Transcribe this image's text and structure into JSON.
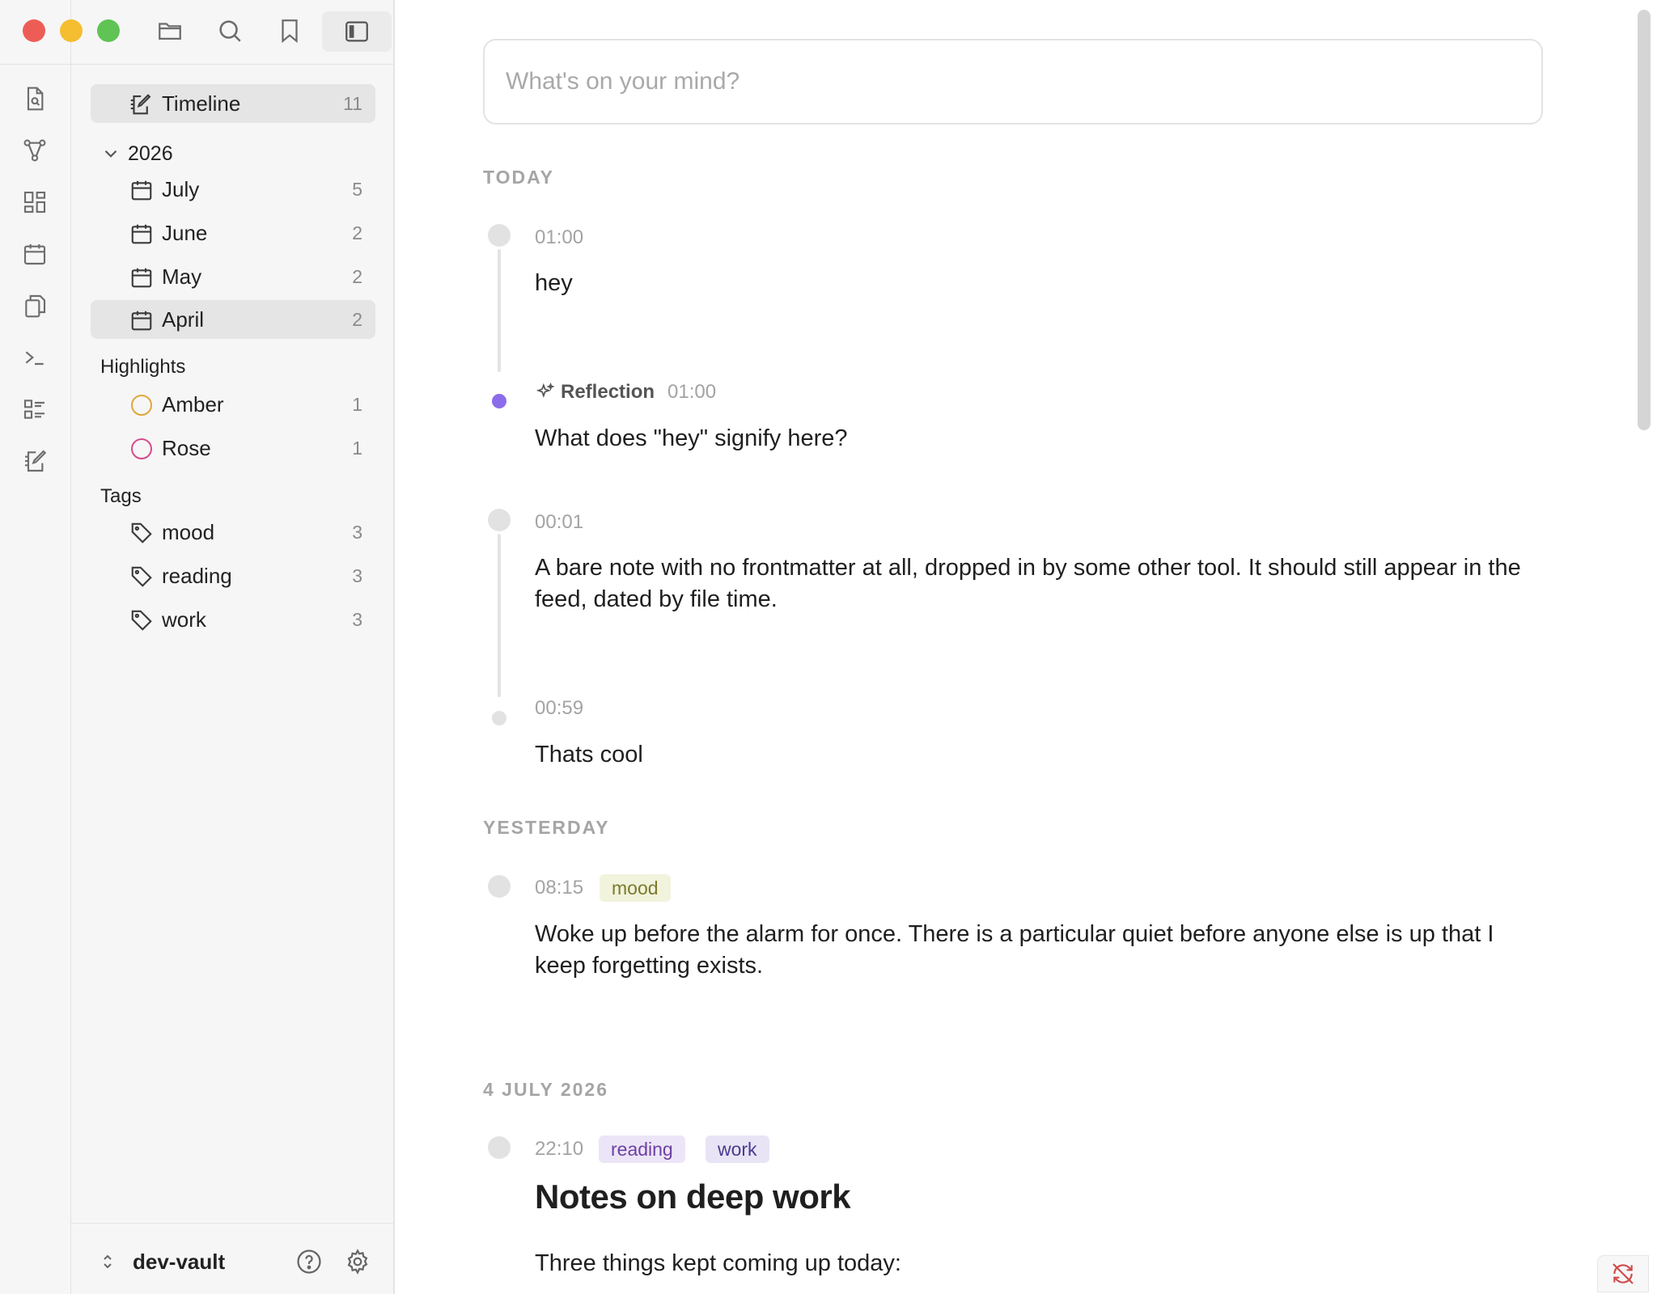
{
  "window": {
    "traffic_colors": [
      "#ee5d55",
      "#f5be30",
      "#5fc454"
    ]
  },
  "sidebar": {
    "timeline": {
      "label": "Timeline",
      "count": "11"
    },
    "year": {
      "label": "2026"
    },
    "months": [
      {
        "label": "July",
        "count": "5"
      },
      {
        "label": "June",
        "count": "2"
      },
      {
        "label": "May",
        "count": "2"
      },
      {
        "label": "April",
        "count": "2"
      }
    ],
    "highlights": {
      "heading": "Highlights",
      "items": [
        {
          "label": "Amber",
          "count": "1",
          "color": "#e0a63a"
        },
        {
          "label": "Rose",
          "count": "1",
          "color": "#d64b8c"
        }
      ]
    },
    "tags": {
      "heading": "Tags",
      "items": [
        {
          "label": "mood",
          "count": "3"
        },
        {
          "label": "reading",
          "count": "3"
        },
        {
          "label": "work",
          "count": "3"
        }
      ]
    },
    "vault": {
      "name": "dev-vault"
    }
  },
  "composer": {
    "placeholder": "What's on your mind?"
  },
  "feed": {
    "today": {
      "heading": "TODAY",
      "entries": [
        {
          "time": "01:00",
          "text": "hey"
        },
        {
          "label": "Reflection",
          "time": "01:00",
          "text": "What does \"hey\" signify here?"
        },
        {
          "time": "00:01",
          "text": "A bare note with no frontmatter at all, dropped in by some other tool. It should still appear in the feed, dated by file time."
        },
        {
          "time": "00:59",
          "text": "Thats cool"
        }
      ]
    },
    "yesterday": {
      "heading": "YESTERDAY",
      "entries": [
        {
          "time": "08:15",
          "tag": "mood",
          "text": "Woke up before the alarm for once. There is a particular quiet before anyone else is up that I keep forgetting exists."
        }
      ]
    },
    "july4": {
      "heading": "4 JULY 2026",
      "entries": [
        {
          "time": "22:10",
          "tags": [
            "reading",
            "work"
          ],
          "title": "Notes on deep work",
          "text": "Three things kept coming up today:"
        }
      ]
    }
  }
}
